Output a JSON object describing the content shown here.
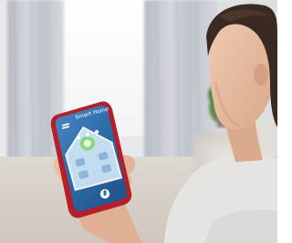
{
  "scene": {
    "description_colors": {
      "wall": "#e6e8ea",
      "curtain": "#c9ccd2",
      "window_light": "#ffffff",
      "floor": "#d8d2cb",
      "skin": "#e2b79c",
      "hair": "#3b2a22",
      "phone_case": "#b3202a",
      "screen_bg": "#2a6aa8",
      "house_accent": "#7fd66a"
    },
    "icons": [
      "house-icon",
      "menu-icon",
      "microphone-icon"
    ]
  },
  "phone_screen": {
    "app_title": "Smart Home"
  }
}
